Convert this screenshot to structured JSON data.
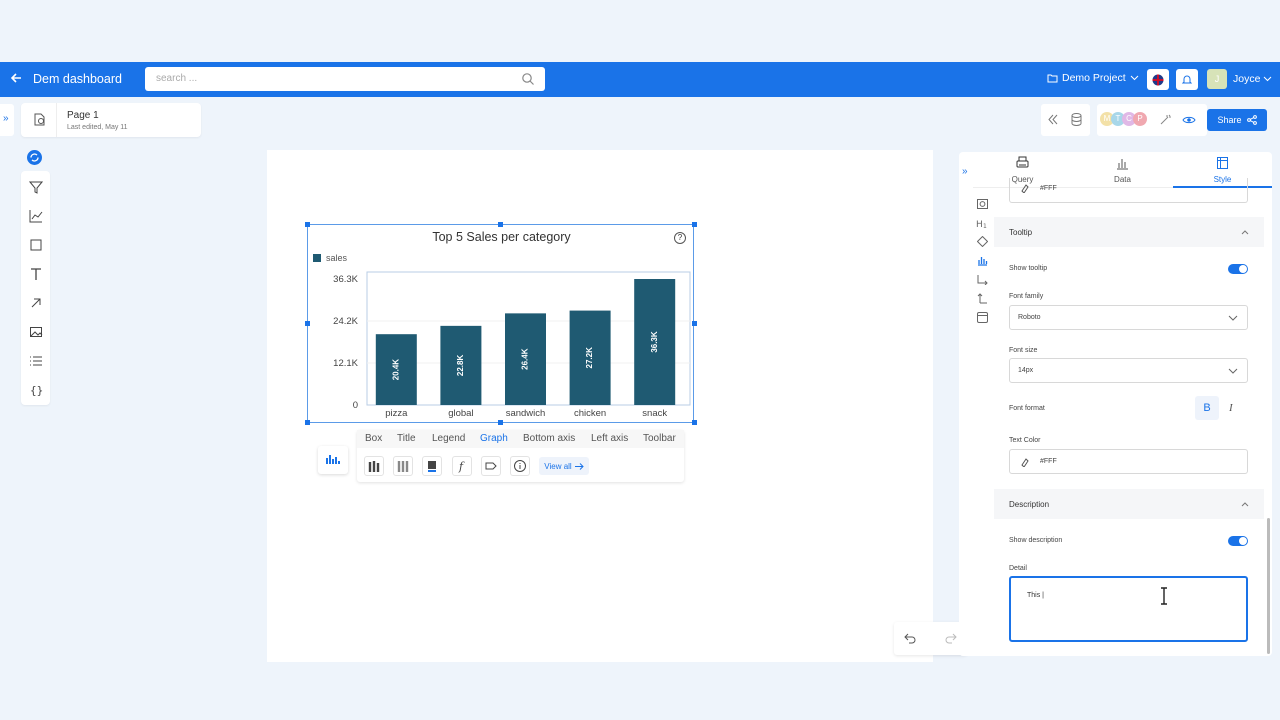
{
  "header": {
    "title": "Dem dashboard",
    "search_placeholder": "search ...",
    "project": "Demo Project",
    "user_initial": "J",
    "user_name": "Joyce"
  },
  "page": {
    "name": "Page 1",
    "last_edited": "Last edited, May 11"
  },
  "actions": {
    "share_label": "Share",
    "avatar_letters": [
      "M",
      "T",
      "C",
      "P"
    ]
  },
  "chart_data": {
    "type": "bar",
    "title": "Top 5 Sales per category",
    "categories": [
      "pizza",
      "global",
      "sandwich",
      "chicken",
      "snack"
    ],
    "series": [
      {
        "name": "sales",
        "values": [
          20400,
          22800,
          26400,
          27200,
          36300
        ],
        "labels": [
          "20.4K",
          "22.8K",
          "26.4K",
          "27.2K",
          "36.3K"
        ]
      }
    ],
    "y_ticks": [
      "0",
      "12.1K",
      "24.2K",
      "36.3K"
    ],
    "ylim": [
      0,
      36300
    ],
    "bar_color": "#1f5a72",
    "legend": "top-left"
  },
  "chart_tabs": [
    "Box",
    "Title",
    "Legend",
    "Graph",
    "Bottom axis",
    "Left axis",
    "Toolbar"
  ],
  "chart_tab_active": "Graph",
  "view_all": "View all",
  "right_panel": {
    "tabs": [
      "Query",
      "Data",
      "Style"
    ],
    "active_tab": "Style",
    "top_color": "#FFF",
    "tooltip": {
      "header": "Tooltip",
      "show_label": "Show tooltip",
      "font_family_label": "Font family",
      "font_family": "Roboto",
      "font_size_label": "Font size",
      "font_size": "14px",
      "font_format_label": "Font format",
      "bold": "B",
      "italic": "I",
      "text_color_label": "Text Color",
      "text_color": "#FFF"
    },
    "description": {
      "header": "Description",
      "show_label": "Show description",
      "detail_label": "Detail",
      "detail_value": "This |"
    }
  },
  "colors": {
    "accent": "#1a73e8",
    "bar": "#1f5a72"
  }
}
